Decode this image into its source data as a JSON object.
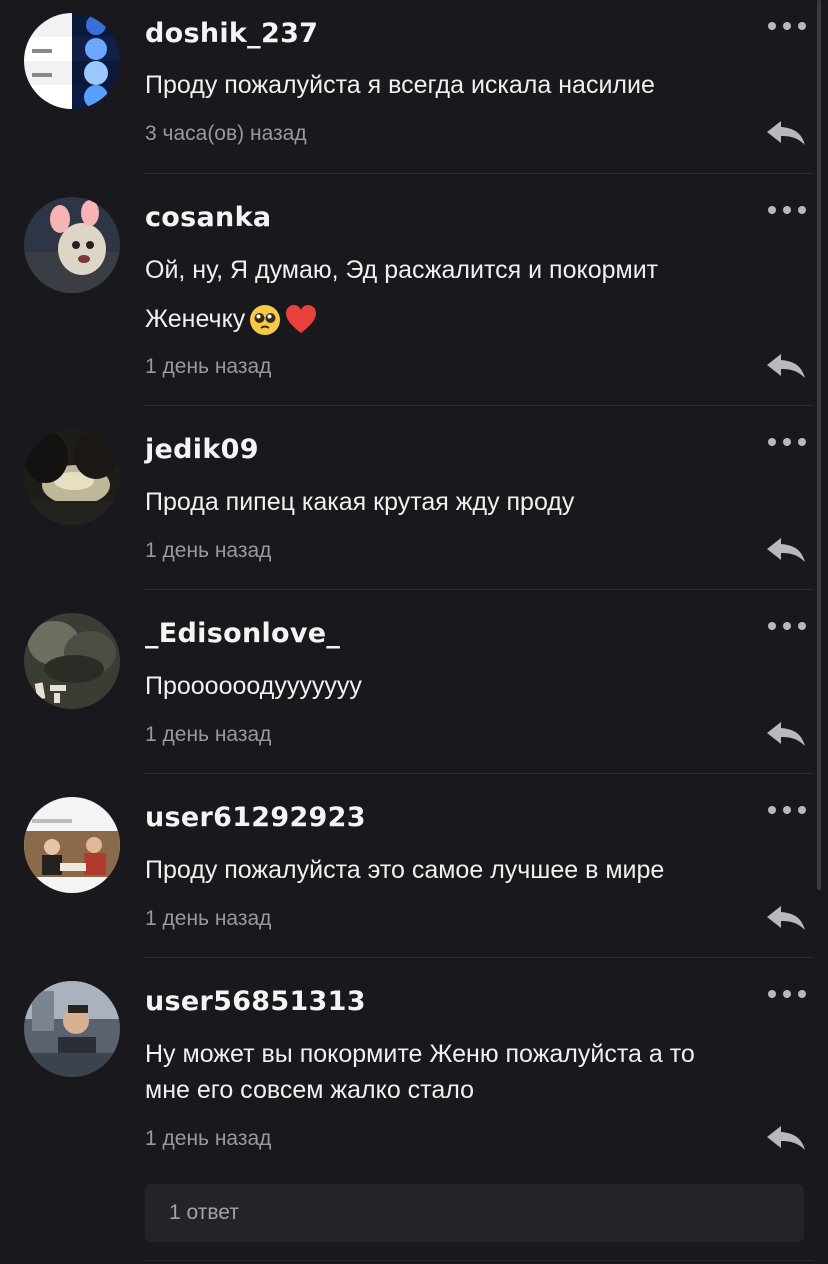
{
  "comments": [
    {
      "username": "doshik_237",
      "text": "Проду пожалуйста я всегда искала насилие",
      "time": "3 часа(ов) назад"
    },
    {
      "username": "cosanka",
      "text": "Ой, ну, Я думаю, Эд расжалится и покормит",
      "text2": "Женечку",
      "time": "1 день назад"
    },
    {
      "username": "jedik09",
      "text": "Прода пипец какая крутая жду проду",
      "time": "1 день назад"
    },
    {
      "username": "_Edisonlove_",
      "text": "Проооооодууууууу",
      "time": "1 день назад"
    },
    {
      "username": "user61292923",
      "text": "Проду пожалуйста это самое лучшее в мире",
      "time": "1 день назад"
    },
    {
      "username": "user56851313",
      "text": "Ну может вы покормите Женю  пожалуйста а то",
      "text2": "мне его совсем  жалко стало",
      "time": "1 день назад"
    }
  ],
  "replies": {
    "label": "1 ответ"
  },
  "icons": {
    "more": "more-dots-icon",
    "reply": "reply-arrow-icon",
    "emoji_1": "pleading-face-emoji",
    "emoji_2": "red-heart-emoji"
  },
  "colors": {
    "background": "#19181c",
    "text": "#f0f0f0",
    "muted": "#9a999e",
    "icon": "#b9b8bd"
  }
}
